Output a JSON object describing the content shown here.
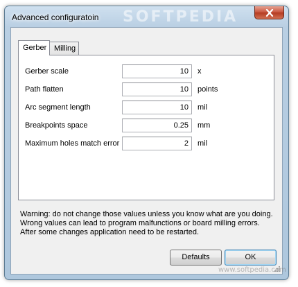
{
  "window": {
    "title": "Advanced configuratoin",
    "watermark": "SOFTPEDIA"
  },
  "tabs": [
    {
      "label": "Gerber",
      "active": true
    },
    {
      "label": "Milling",
      "active": false
    }
  ],
  "fields": [
    {
      "label": "Gerber scale",
      "value": "10",
      "unit": "x"
    },
    {
      "label": "Path flatten",
      "value": "10",
      "unit": "points"
    },
    {
      "label": "Arc segment length",
      "value": "10",
      "unit": "mil"
    },
    {
      "label": "Breakpoints space",
      "value": "0.25",
      "unit": "mm"
    },
    {
      "label": "Maximum holes match error",
      "value": "2",
      "unit": "mil"
    }
  ],
  "warning": {
    "line1": "Warning: do not change those values unless you know what are you doing.",
    "line2": "Wrong values can lead to program malfunctions or board milling errors.",
    "line3": "After some changes application need to be restarted."
  },
  "buttons": {
    "defaults": "Defaults",
    "ok": "OK"
  },
  "site_watermark": "www.softpedia.com",
  "colors": {
    "frame": "#b9cfe3",
    "close_button": "#c7533b",
    "default_button_border": "#3c7fb1"
  }
}
